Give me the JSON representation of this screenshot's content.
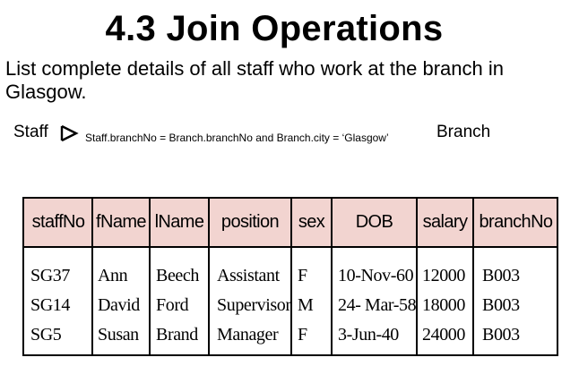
{
  "title": "4.3 Join Operations",
  "question": "List complete details of all staff who work at the branch in Glasgow.",
  "expression": {
    "left_relation": "Staff",
    "join_icon": "semijoin-icon",
    "condition": "Staff.branchNo = Branch.branchNo and Branch.city = ‘Glasgow’",
    "right_relation": "Branch"
  },
  "table": {
    "header_color": "#f2d4d0",
    "columns": [
      "staffNo",
      "fName",
      "lName",
      "position",
      "sex",
      "DOB",
      "salary",
      "branchNo"
    ],
    "rows": [
      [
        "SG37",
        "Ann",
        "Beech",
        "Assistant",
        "F",
        "10-Nov-60",
        "12000",
        "B003"
      ],
      [
        "SG14",
        "David",
        "Ford",
        "Supervisor",
        "M",
        "24- Mar-58",
        "18000",
        "B003"
      ],
      [
        "SG5",
        "Susan",
        "Brand",
        "Manager",
        "F",
        "3-Jun-40",
        "24000",
        "B003"
      ]
    ]
  }
}
